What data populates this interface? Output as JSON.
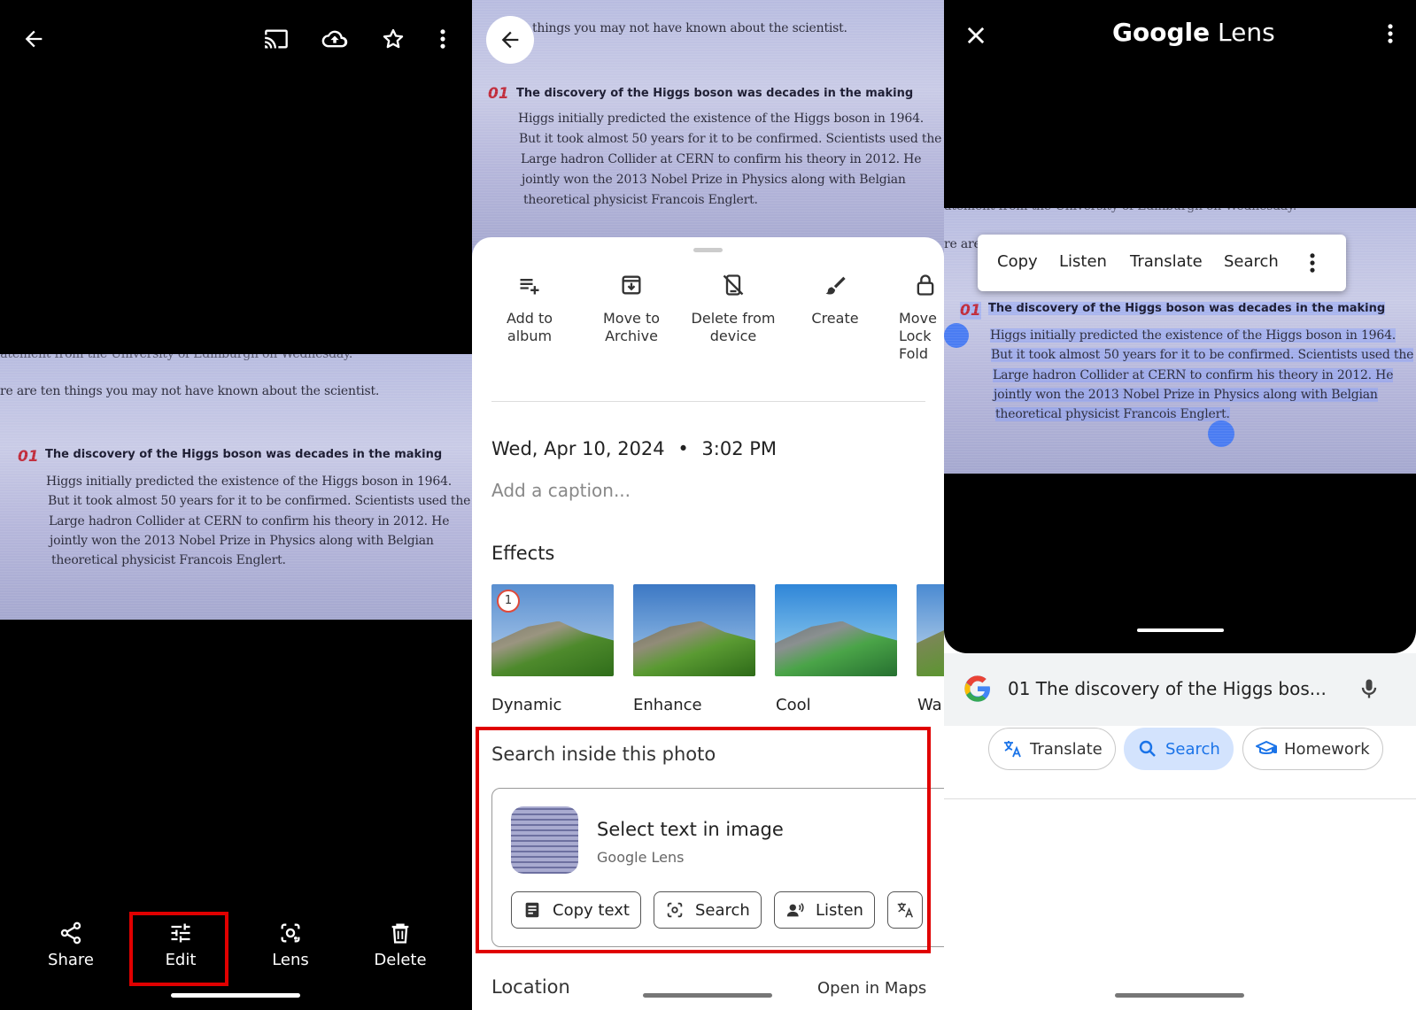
{
  "panel1": {
    "bottom_bar": {
      "share": "Share",
      "edit": "Edit",
      "lens": "Lens",
      "delete": "Delete"
    },
    "icons": [
      "back-arrow-icon",
      "cast-icon",
      "cloud-upload-icon",
      "star-icon",
      "more-vert-icon"
    ]
  },
  "photo": {
    "top_line": "latement from the University of Edinburgh on Wednesday.",
    "intro": "re are ten things you may not have known about the scientist.",
    "intro_short": "things you may not have known about the scientist.",
    "number": "01",
    "heading": "The discovery of the Higgs boson was decades in the making",
    "lines": [
      "Higgs initially predicted the existence of the Higgs boson in 1964.",
      "But it took almost 50 years for it to be confirmed. Scientists used the",
      "Large hadron Collider at CERN to confirm his theory in 2012. He",
      "jointly won the 2013 Nobel Prize in Physics along with Belgian",
      "theoretical physicist Francois Englert."
    ]
  },
  "panel2": {
    "actions": [
      {
        "label1": "Add to",
        "label2": "album",
        "icon": "add-to-album-icon"
      },
      {
        "label1": "Move to",
        "label2": "Archive",
        "icon": "archive-icon"
      },
      {
        "label1": "Delete from",
        "label2": "device",
        "icon": "delete-device-icon"
      },
      {
        "label1": "Create",
        "label2": "",
        "icon": "brush-icon"
      },
      {
        "label1": "Move",
        "label2": "Lock",
        "label3": "Fold",
        "icon": "lock-icon"
      }
    ],
    "date": "Wed, Apr 10, 2024",
    "time": "3:02 PM",
    "caption_placeholder": "Add a caption...",
    "effects_title": "Effects",
    "effects": [
      "Dynamic",
      "Enhance",
      "Cool",
      "Wa"
    ],
    "search_section_title": "Search inside this photo",
    "lens_card": {
      "title": "Select text in image",
      "subtitle": "Google Lens",
      "chips": [
        "Copy text",
        "Search",
        "Listen"
      ]
    },
    "location_label": "Location",
    "open_in_maps": "Open in Maps"
  },
  "panel3": {
    "title_google": "Google",
    "title_lens": "Lens",
    "context_menu": [
      "Copy",
      "Listen",
      "Translate",
      "Search"
    ],
    "search_query": "01 The discovery of the Higgs bos...",
    "pills": [
      "Translate",
      "Search",
      "Homework"
    ],
    "colors": {
      "accent": "#1a73e8",
      "pill_selected_bg": "#d3e3fd"
    }
  }
}
